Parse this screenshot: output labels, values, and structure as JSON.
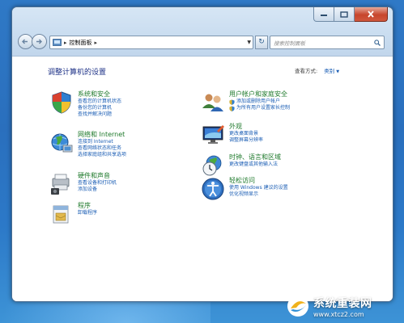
{
  "window": {
    "breadcrumb": "控制面板",
    "search_placeholder": "搜索控制面板"
  },
  "content": {
    "title": "调整计算机的设置",
    "view_by_label": "查看方式:",
    "view_by_value": "类别"
  },
  "categories_left": [
    {
      "title": "系统和安全",
      "icon": "system-security-icon",
      "links": [
        "查看您的计算机状态",
        "备份您的计算机",
        "查找并解决问题"
      ]
    },
    {
      "title": "网络和 Internet",
      "icon": "network-icon",
      "links": [
        "连接到 Internet",
        "查看网络状态和任务",
        "选择家庭组和共享选项"
      ]
    },
    {
      "title": "硬件和声音",
      "icon": "hardware-sound-icon",
      "links": [
        "查看设备和打印机",
        "添加设备"
      ]
    },
    {
      "title": "程序",
      "icon": "programs-icon",
      "links": [
        "卸载程序"
      ]
    }
  ],
  "categories_right": [
    {
      "title": "用户帐户和家庭安全",
      "icon": "user-accounts-icon",
      "links": [
        "添加或删除用户帐户",
        "为所有用户设置家长控制"
      ]
    },
    {
      "title": "外观",
      "icon": "appearance-icon",
      "links": [
        "更改桌面背景",
        "调整屏幕分辨率"
      ]
    },
    {
      "title": "时钟、语言和区域",
      "icon": "clock-language-icon",
      "links": [
        "更改键盘或其他输入法"
      ]
    },
    {
      "title": "轻松访问",
      "icon": "ease-of-access-icon",
      "links": [
        "使用 Windows 建议的设置",
        "优化视频显示"
      ]
    }
  ],
  "watermark": {
    "name": "系统重装网",
    "url": "www.xtcz2.com"
  },
  "colors": {
    "category_title": "#1f7a2c",
    "link": "#1a5db4",
    "page_title": "#1e3287"
  }
}
